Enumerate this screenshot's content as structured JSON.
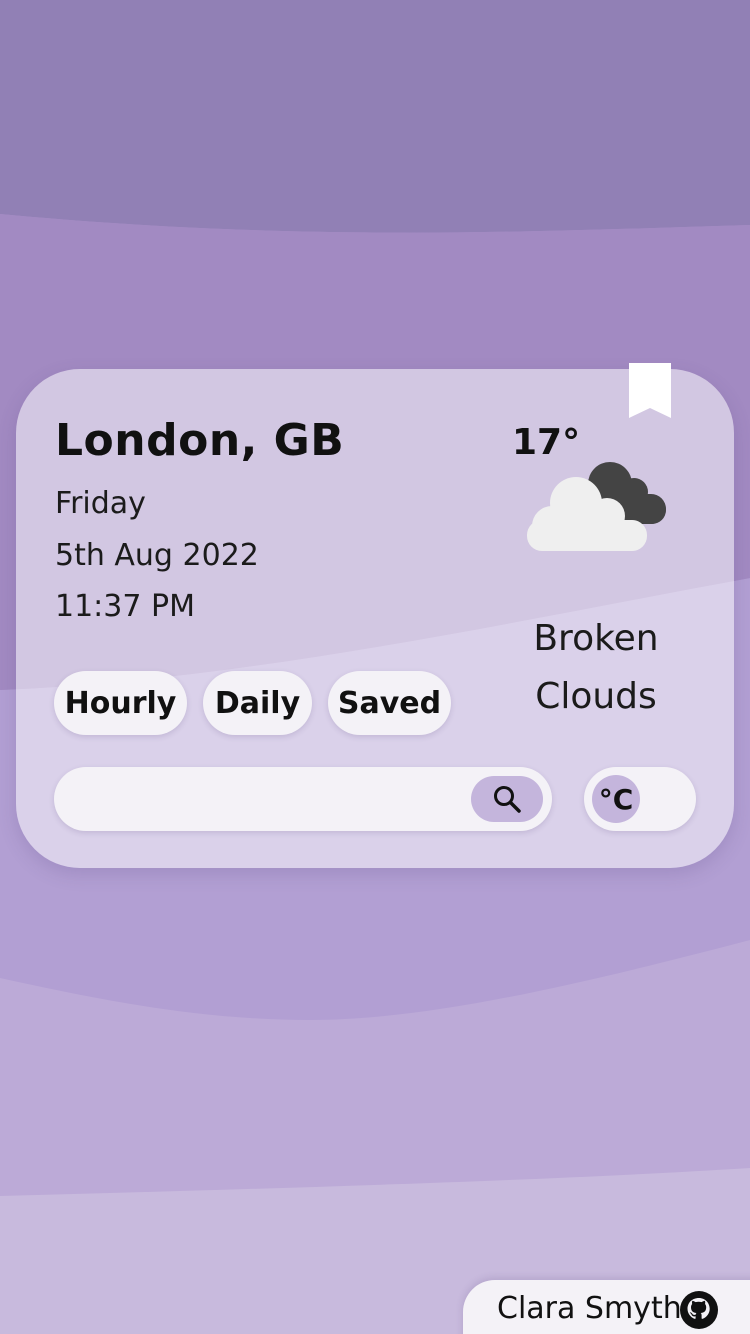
{
  "location": {
    "city": "London, GB",
    "day": "Friday",
    "date": "5th Aug 2022",
    "time": "11:37 PM"
  },
  "weather": {
    "temperature": "17°",
    "condition_line1": "Broken",
    "condition_line2": "Clouds",
    "icon": "broken-clouds-icon"
  },
  "tabs": {
    "hourly": "Hourly",
    "daily": "Daily",
    "saved": "Saved"
  },
  "search": {
    "value": "",
    "placeholder": "",
    "icon": "search-icon"
  },
  "unit_toggle": {
    "label": "°C"
  },
  "footer": {
    "author": "Clara Smyth",
    "icon": "github-icon"
  },
  "bookmark": {
    "icon": "bookmark-icon"
  },
  "colors": {
    "background_top": "#9180b5",
    "background_bottom": "#c8badd",
    "accent": "#c4b5dc",
    "pill_bg": "#f4f2f7"
  }
}
